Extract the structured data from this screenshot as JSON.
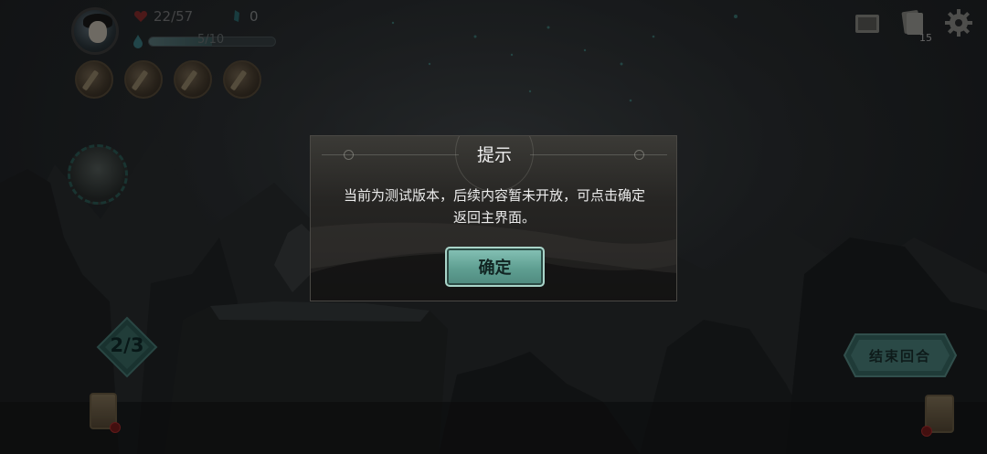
{
  "hud": {
    "hp": "22/57",
    "gems": "0",
    "energy_text": "5/10",
    "energy_fraction": 0.5,
    "deck_count": "15",
    "floor": "2/3",
    "end_turn_label": "结束回合"
  },
  "dialog": {
    "title": "提示",
    "message_line1": "当前为测试版本，后续内容暂未开放，可点击确定",
    "message_line2": "返回主界面。",
    "confirm_label": "确定"
  },
  "colors": {
    "accent": "#6aa99c",
    "hp_red": "#b23a3a",
    "gem_teal": "#3f8f95"
  },
  "icons": {
    "hp": "heart-icon",
    "gem": "crystal-icon",
    "energy": "water-drop-icon",
    "map": "map-scroll-icon",
    "deck": "card-deck-icon",
    "settings": "gear-icon"
  }
}
